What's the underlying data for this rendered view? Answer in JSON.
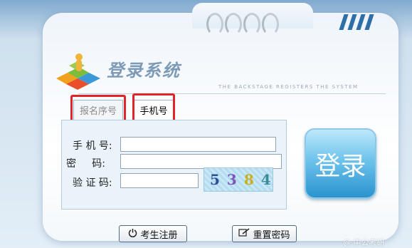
{
  "header": {
    "title": "登录系统",
    "subtitle": "THE BACKSTAGE REGISTERS THE SYSTEM"
  },
  "tabs": [
    {
      "label": "报名序号"
    },
    {
      "label": "手机号"
    }
  ],
  "form": {
    "phone_label": "手 机 号:",
    "password_label": "密     码:",
    "captcha_label": "验 证 码:",
    "phone_value": "",
    "password_value": "",
    "captcha_value": "",
    "captcha_text": "5384"
  },
  "buttons": {
    "login": "登录",
    "register": "考生注册",
    "reset_password": "重置密码"
  },
  "watermark": "@ 中公考研",
  "colors": {
    "accent_blue": "#2a93cf",
    "highlight_red": "#e0242c"
  },
  "icons": [
    "logo-icon",
    "power-icon",
    "edit-icon"
  ]
}
